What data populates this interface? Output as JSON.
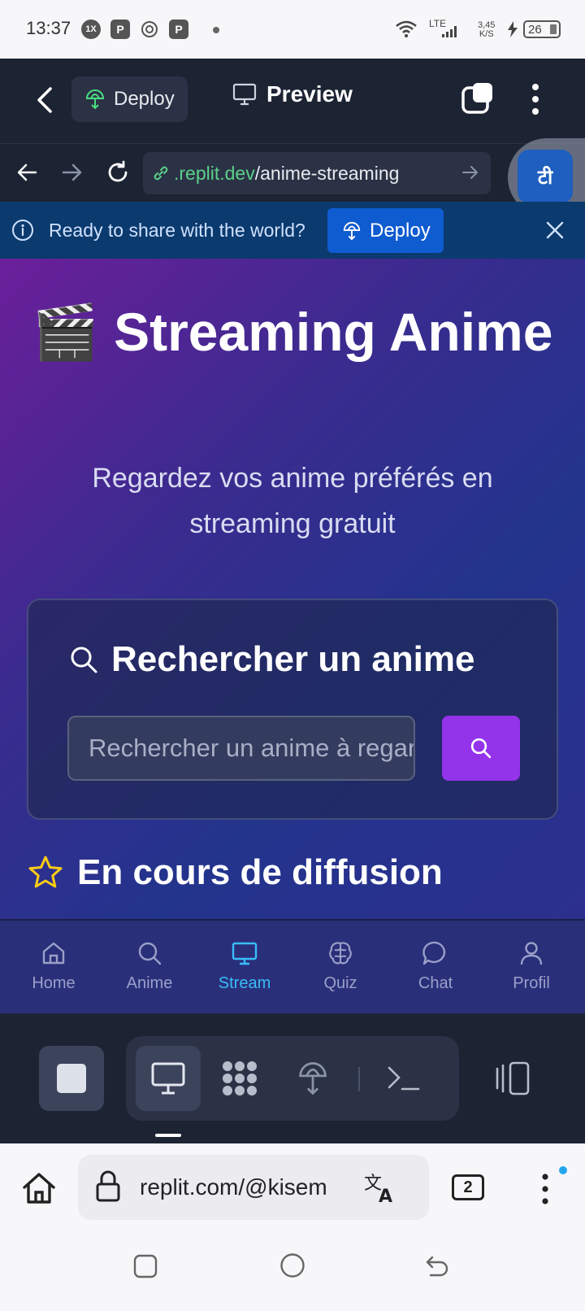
{
  "status_bar": {
    "time": "13:37",
    "app_icons": [
      "1X",
      "P",
      "openai-icon",
      "P"
    ],
    "network": "LTE",
    "speed_value": "3,45",
    "speed_unit": "K/S",
    "battery": "26"
  },
  "replit_header": {
    "deploy_label": "Deploy",
    "preview_label": "Preview"
  },
  "url_bar": {
    "host": ".replit.dev",
    "path": "/anime-streaming",
    "floating_badge": "टी"
  },
  "banner": {
    "message": "Ready to share with the world?",
    "deploy_label": "Deploy"
  },
  "page": {
    "title_emoji": "🎬",
    "title": "Streaming Anime",
    "subtitle": "Regardez vos anime préférés en streaming gratuit",
    "search_card": {
      "heading": "Rechercher un anime",
      "placeholder": "Rechercher un anime à regarder..."
    },
    "section_title": "En cours de diffusion"
  },
  "app_nav": {
    "items": [
      {
        "label": "Home",
        "icon": "home-icon",
        "active": false
      },
      {
        "label": "Anime",
        "icon": "search-icon",
        "active": false
      },
      {
        "label": "Stream",
        "icon": "monitor-icon",
        "active": true
      },
      {
        "label": "Quiz",
        "icon": "brain-icon",
        "active": false
      },
      {
        "label": "Chat",
        "icon": "chat-icon",
        "active": false
      },
      {
        "label": "Profil",
        "icon": "user-icon",
        "active": false
      }
    ],
    "active_color": "#38bdf8"
  },
  "browser": {
    "url": "replit.com/@kisem",
    "tab_count": "2"
  },
  "colors": {
    "replit_dark": "#1c2333",
    "search_button": "#9333ea",
    "banner_bg": "#0b3a6e",
    "deploy_button": "#0f5bd0"
  }
}
